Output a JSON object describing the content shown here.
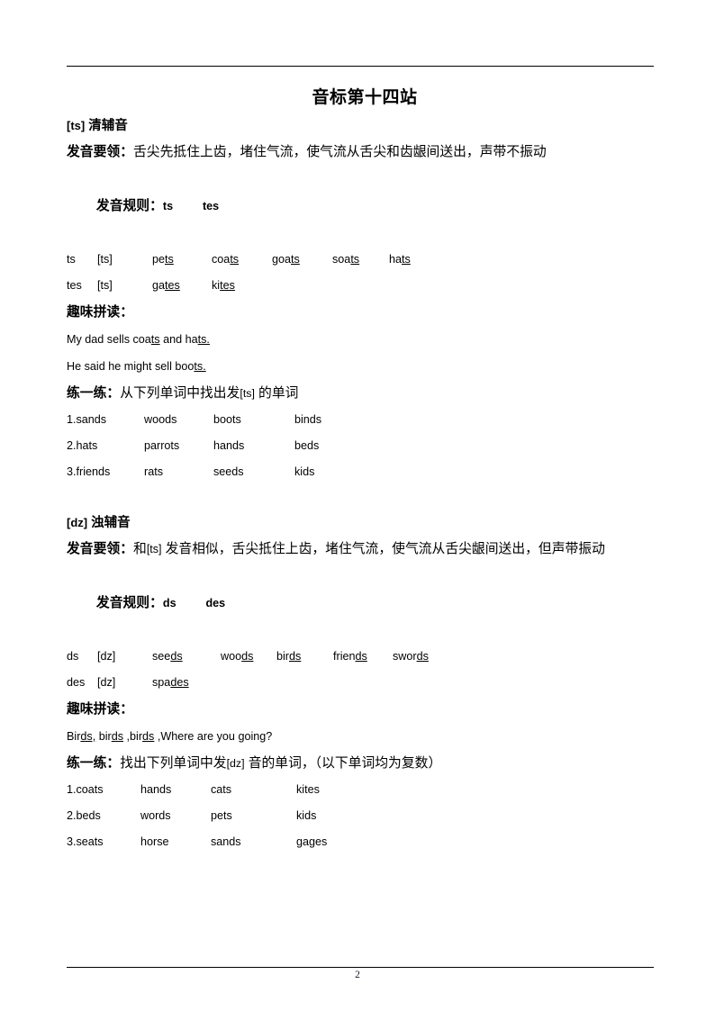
{
  "document": {
    "title": "音标第十四站",
    "page_number": "2"
  },
  "sections": [
    {
      "id": "ts",
      "heading_symbol": "[ts]",
      "heading_text": "清辅音",
      "essentials_label": "发音要领：",
      "essentials_text": "舌尖先抵住上齿，堵住气流，使气流从舌尖和齿龈间送出，声带不振动",
      "rules_label": "发音规则：",
      "rules_codes": [
        "ts",
        "tes"
      ],
      "rule_rows": [
        {
          "spelling": "ts",
          "phonetic": "[ts]",
          "words": [
            {
              "stem": "pe",
              "suffix": "ts"
            },
            {
              "stem": "coa",
              "suffix": "ts"
            },
            {
              "stem": "goa",
              "suffix": "ts"
            },
            {
              "stem": "soa",
              "suffix": "ts"
            },
            {
              "stem": "ha",
              "suffix": "ts"
            }
          ]
        },
        {
          "spelling": "tes",
          "phonetic": "[ts]",
          "words": [
            {
              "stem": "ga",
              "suffix": "tes"
            },
            {
              "stem": "ki",
              "suffix": "tes"
            }
          ]
        }
      ],
      "fun_label": "趣味拼读：",
      "fun_sentences": [
        [
          {
            "t": "My dad sells coa",
            "u": false
          },
          {
            "t": "ts",
            "u": true
          },
          {
            "t": " and ha",
            "u": false
          },
          {
            "t": "ts.",
            "u": true
          }
        ],
        [
          {
            "t": "He said he might sell boo",
            "u": false
          },
          {
            "t": "ts.",
            "u": true
          }
        ]
      ],
      "practice_label": "练一练：",
      "practice_text_pre": "从下列单词中找出发",
      "practice_phonetic": "[ts]",
      "practice_text_post": " 的单词",
      "practice_rows": [
        [
          "1.sands",
          "woods",
          "boots",
          "binds"
        ],
        [
          "2.hats",
          "parrots",
          "hands",
          "beds"
        ],
        [
          "3.friends",
          "rats",
          "seeds",
          "kids"
        ]
      ]
    },
    {
      "id": "dz",
      "heading_symbol": "[dz]",
      "heading_text": "浊辅音",
      "essentials_label": "发音要领：",
      "essentials_text_pre": "和",
      "essentials_phonetic": "[ts]",
      "essentials_text_post": " 发音相似，舌尖抵住上齿，堵住气流，使气流从舌尖龈间送出，但声带振动",
      "rules_label": "发音规则：",
      "rules_codes": [
        "ds",
        "des"
      ],
      "rule_rows": [
        {
          "spelling": "ds",
          "phonetic": "[dz]",
          "words": [
            {
              "stem": "see",
              "suffix": "ds"
            },
            {
              "stem": "woo",
              "suffix": "ds"
            },
            {
              "stem": "bir",
              "suffix": "ds"
            },
            {
              "stem": "frien",
              "suffix": "ds"
            },
            {
              "stem": "swor",
              "suffix": "ds"
            }
          ]
        },
        {
          "spelling": "des",
          "phonetic": "[dz]",
          "words": [
            {
              "stem": "spa",
              "suffix": "des"
            }
          ]
        }
      ],
      "fun_label": "趣味拼读：",
      "fun_sentences": [
        [
          {
            "t": "Bir",
            "u": false
          },
          {
            "t": "ds,",
            "u": true
          },
          {
            "t": " bir",
            "u": false
          },
          {
            "t": "ds",
            "u": true
          },
          {
            "t": " ,bir",
            "u": false
          },
          {
            "t": "ds",
            "u": true
          },
          {
            "t": " ,Where are you going?",
            "u": false
          }
        ]
      ],
      "practice_label": "练一练：",
      "practice_text_pre": "找出下列单词中发",
      "practice_phonetic": "[dz]",
      "practice_text_post": " 音的单词，（以下单词均为复数）",
      "practice_rows": [
        [
          "1.coats",
          "hands",
          "cats",
          "kites"
        ],
        [
          "2.beds",
          "words",
          "pets",
          "kids"
        ],
        [
          "3.seats",
          "horse",
          "sands",
          "gages"
        ]
      ]
    }
  ]
}
